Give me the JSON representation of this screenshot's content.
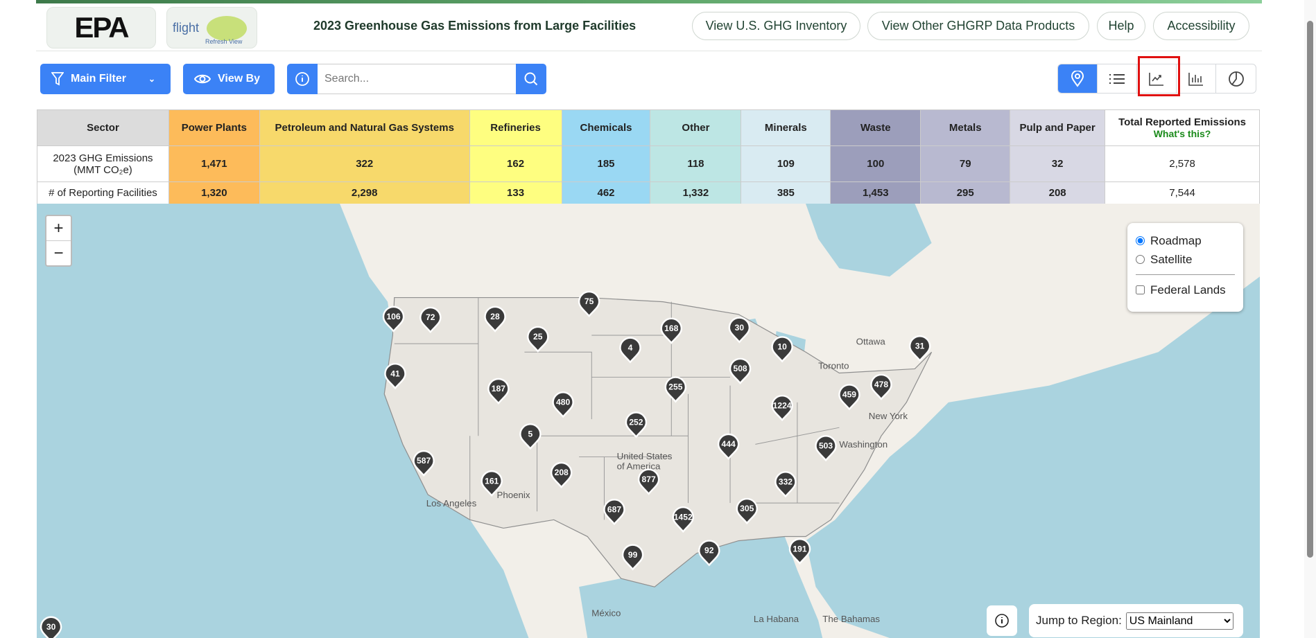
{
  "header": {
    "logo_text": "EPA",
    "flight_logo_text": "flight",
    "flight_sub": "Refresh View",
    "title": "2023 Greenhouse Gas Emissions from Large Facilities",
    "links": [
      "View U.S. GHG Inventory",
      "View Other GHGRP Data Products",
      "Help",
      "Accessibility"
    ]
  },
  "toolbar": {
    "main_filter": "Main Filter",
    "view_by": "View By",
    "search_placeholder": "Search...",
    "views": [
      "map-pin-icon",
      "list-icon",
      "line-chart-icon",
      "bar-chart-icon",
      "pie-chart-icon"
    ],
    "active_view": "map",
    "highlighted_view": "line-chart"
  },
  "table": {
    "headers": [
      "Sector",
      "Power Plants",
      "Petroleum and Natural Gas Systems",
      "Refineries",
      "Chemicals",
      "Other",
      "Minerals",
      "Waste",
      "Metals",
      "Pulp and Paper",
      "Total Reported Emissions"
    ],
    "whats_this": "What's this?",
    "colors": [
      "#dcdcdc",
      "#fdbb5a",
      "#f7d96b",
      "#fefe80",
      "#9ad8f3",
      "#bde6e4",
      "#d9ebf2",
      "#9c9ebb",
      "#b8b9d0",
      "#d8d8e4",
      "#ffffff"
    ],
    "row1_label_a": "2023 GHG Emissions",
    "row1_label_b": "(MMT CO₂e)",
    "emissions": [
      "1,471",
      "322",
      "162",
      "185",
      "118",
      "109",
      "100",
      "79",
      "32",
      "2,578"
    ],
    "row2_label": "# of Reporting Facilities",
    "facilities": [
      "1,320",
      "2,298",
      "133",
      "462",
      "1,332",
      "385",
      "1,453",
      "295",
      "208",
      "7,544"
    ]
  },
  "map": {
    "zoom_in": "+",
    "zoom_out": "−",
    "layers": {
      "roadmap": "Roadmap",
      "satellite": "Satellite",
      "federal": "Federal Lands",
      "selected": "Roadmap"
    },
    "jump_label": "Jump to Region:",
    "jump_value": "US Mainland",
    "place_labels": [
      "Ottawa",
      "Toronto",
      "New York",
      "Washington",
      "United States",
      "of America",
      "Los Angeles",
      "Phoenix",
      "México",
      "La Habana",
      "The Bahamas"
    ],
    "markers": [
      "106",
      "72",
      "28",
      "75",
      "25",
      "4",
      "168",
      "30",
      "10",
      "31",
      "41",
      "508",
      "187",
      "255",
      "480",
      "1224",
      "459",
      "478",
      "252",
      "5",
      "444",
      "503",
      "587",
      "161",
      "208",
      "877",
      "332",
      "687",
      "1452",
      "305",
      "92",
      "191",
      "99",
      "30"
    ]
  }
}
